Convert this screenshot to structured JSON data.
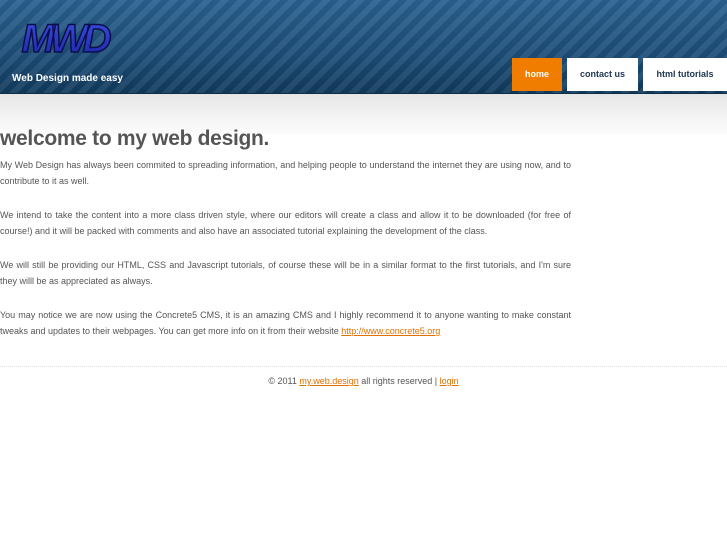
{
  "header": {
    "logo_text": "MWD",
    "tagline": "Web Design made easy"
  },
  "nav": {
    "items": [
      {
        "label": "home",
        "active": true
      },
      {
        "label": "contact us",
        "active": false
      },
      {
        "label": "html tutorials",
        "active": false
      }
    ]
  },
  "main": {
    "title": "welcome to my web design.",
    "paragraphs": [
      "My Web Design has always been commited to spreading information, and helping people to understand the internet they are using now, and to contribute to it as well.",
      "We intend to take the content into a more class driven style, where our editors will create a class and allow it to be downloaded (for free of course!) and it will be packed with comments and also have an associated tutorial explaining the development of the class.",
      "We will still be providing our HTML, CSS and Javascript tutorials, of course these will be in a similar format to the first tutorials, and I'm sure they willl be as appreciated as always."
    ],
    "last_paragraph_text": "You may notice we are now using the Concrete5 CMS, it is an amazing CMS and I highly recommend it to anyone wanting to make constant tweaks and updates to their webpages. You can get more info on it from their website ",
    "last_paragraph_link": "http://www.concrete5.org"
  },
  "footer": {
    "copyright": "© 2011 ",
    "site_link": "my.web.design",
    "rights": " all rights reserved | ",
    "login_link": "login"
  },
  "colors": {
    "header_blue": "#1d4f7a",
    "accent_orange": "#f07c00",
    "link_orange": "#e07000",
    "text_gray": "#555555"
  }
}
